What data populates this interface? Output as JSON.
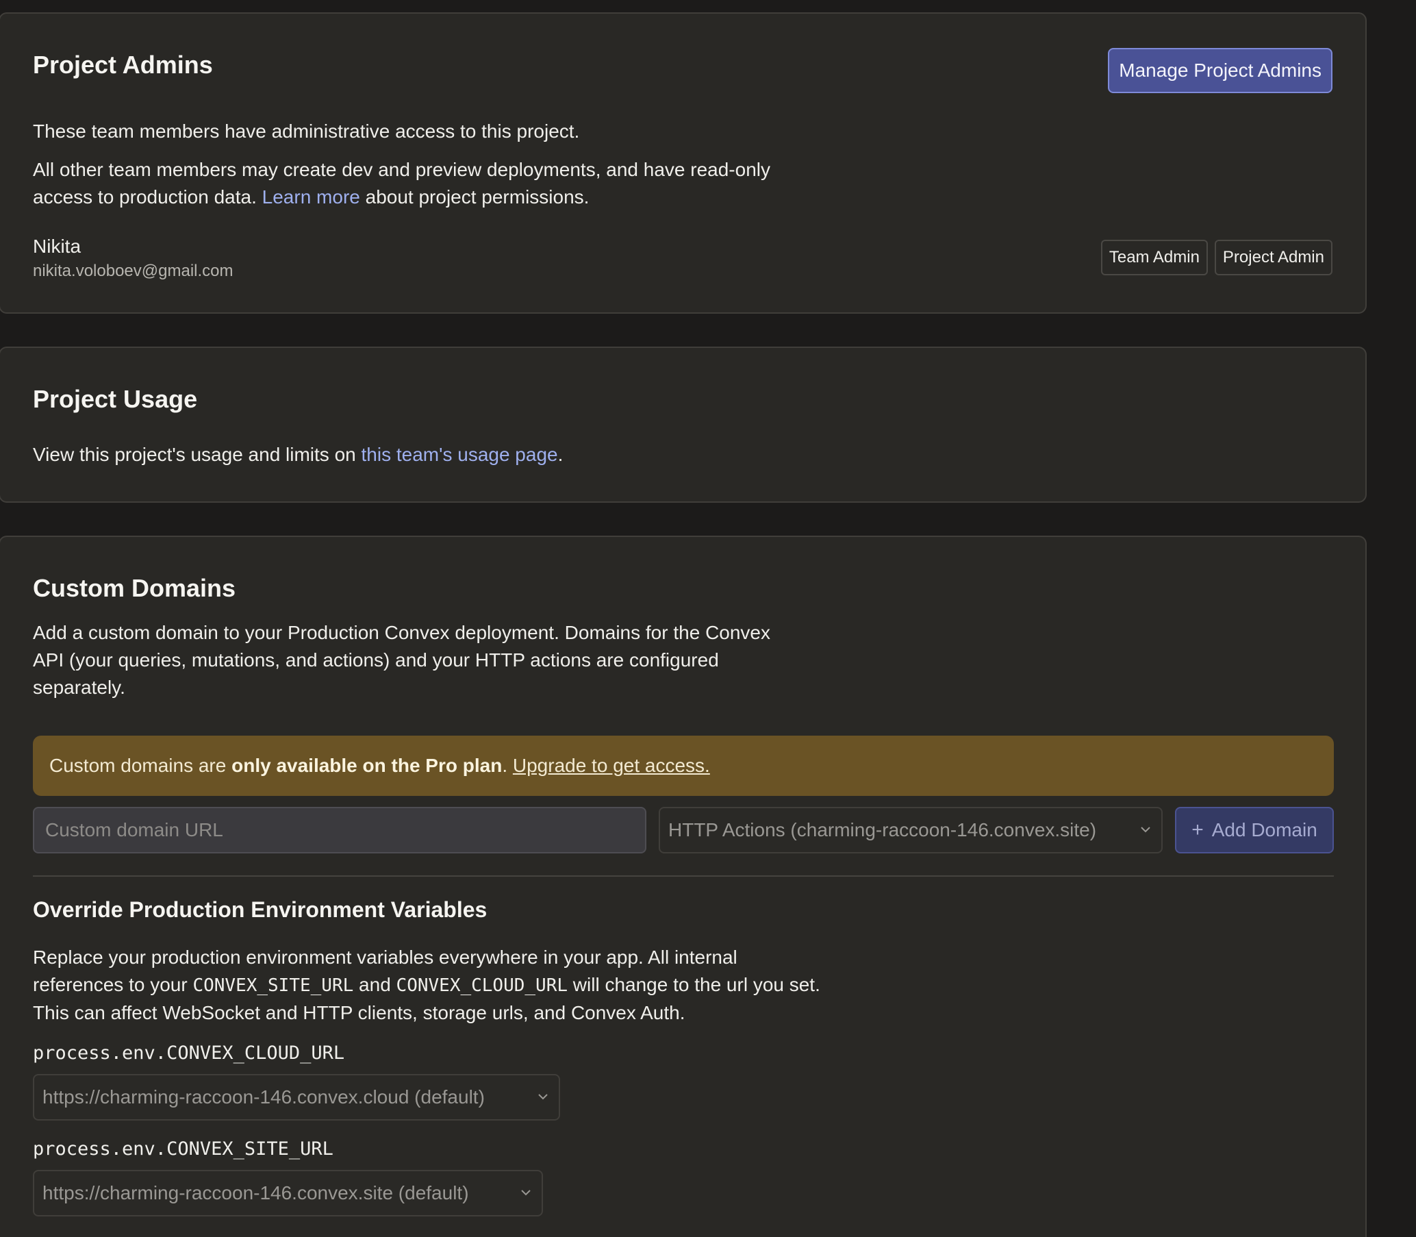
{
  "admins": {
    "title": "Project Admins",
    "manage_button": "Manage Project Admins",
    "description": "These team members have administrative access to this project.",
    "permissions_before": "All other team members may create dev and preview deployments, and have read-only access to production data. ",
    "permissions_link": "Learn more",
    "permissions_after": " about project permissions.",
    "member": {
      "name": "Nikita",
      "email": "nikita.voloboev@gmail.com",
      "badges": [
        "Team Admin",
        "Project Admin"
      ]
    }
  },
  "usage": {
    "title": "Project Usage",
    "text_before": "View this project's usage and limits on ",
    "link": "this team's usage page",
    "text_after": "."
  },
  "domains": {
    "title": "Custom Domains",
    "description": "Add a custom domain to your Production Convex deployment. Domains for the Convex API (your queries, mutations, and actions) and your HTTP actions are configured separately.",
    "banner": {
      "before": "Custom domains are ",
      "bold": "only available on the Pro plan",
      "middle": ". ",
      "link": "Upgrade to get access."
    },
    "input_placeholder": "Custom domain URL",
    "select_value": "HTTP Actions (charming-raccoon-146.convex.site)",
    "add_button": "Add Domain"
  },
  "override": {
    "title": "Override Production Environment Variables",
    "desc_1": "Replace your production environment variables everywhere in your app. All internal references to your ",
    "code_1": "CONVEX_SITE_URL",
    "desc_2": " and ",
    "code_2": "CONVEX_CLOUD_URL",
    "desc_3": " will change to the url you set. This can affect WebSocket and HTTP clients, storage urls, and Convex Auth.",
    "cloud_label": "process.env.CONVEX_CLOUD_URL",
    "cloud_value": "https://charming-raccoon-146.convex.cloud (default)",
    "site_label": "process.env.CONVEX_SITE_URL",
    "site_value": "https://charming-raccoon-146.convex.site (default)"
  },
  "colors": {
    "background": "#1c1b1a",
    "card": "#292825",
    "accent": "#4a5296",
    "banner": "#6a5325",
    "link": "#9fb0ee"
  }
}
